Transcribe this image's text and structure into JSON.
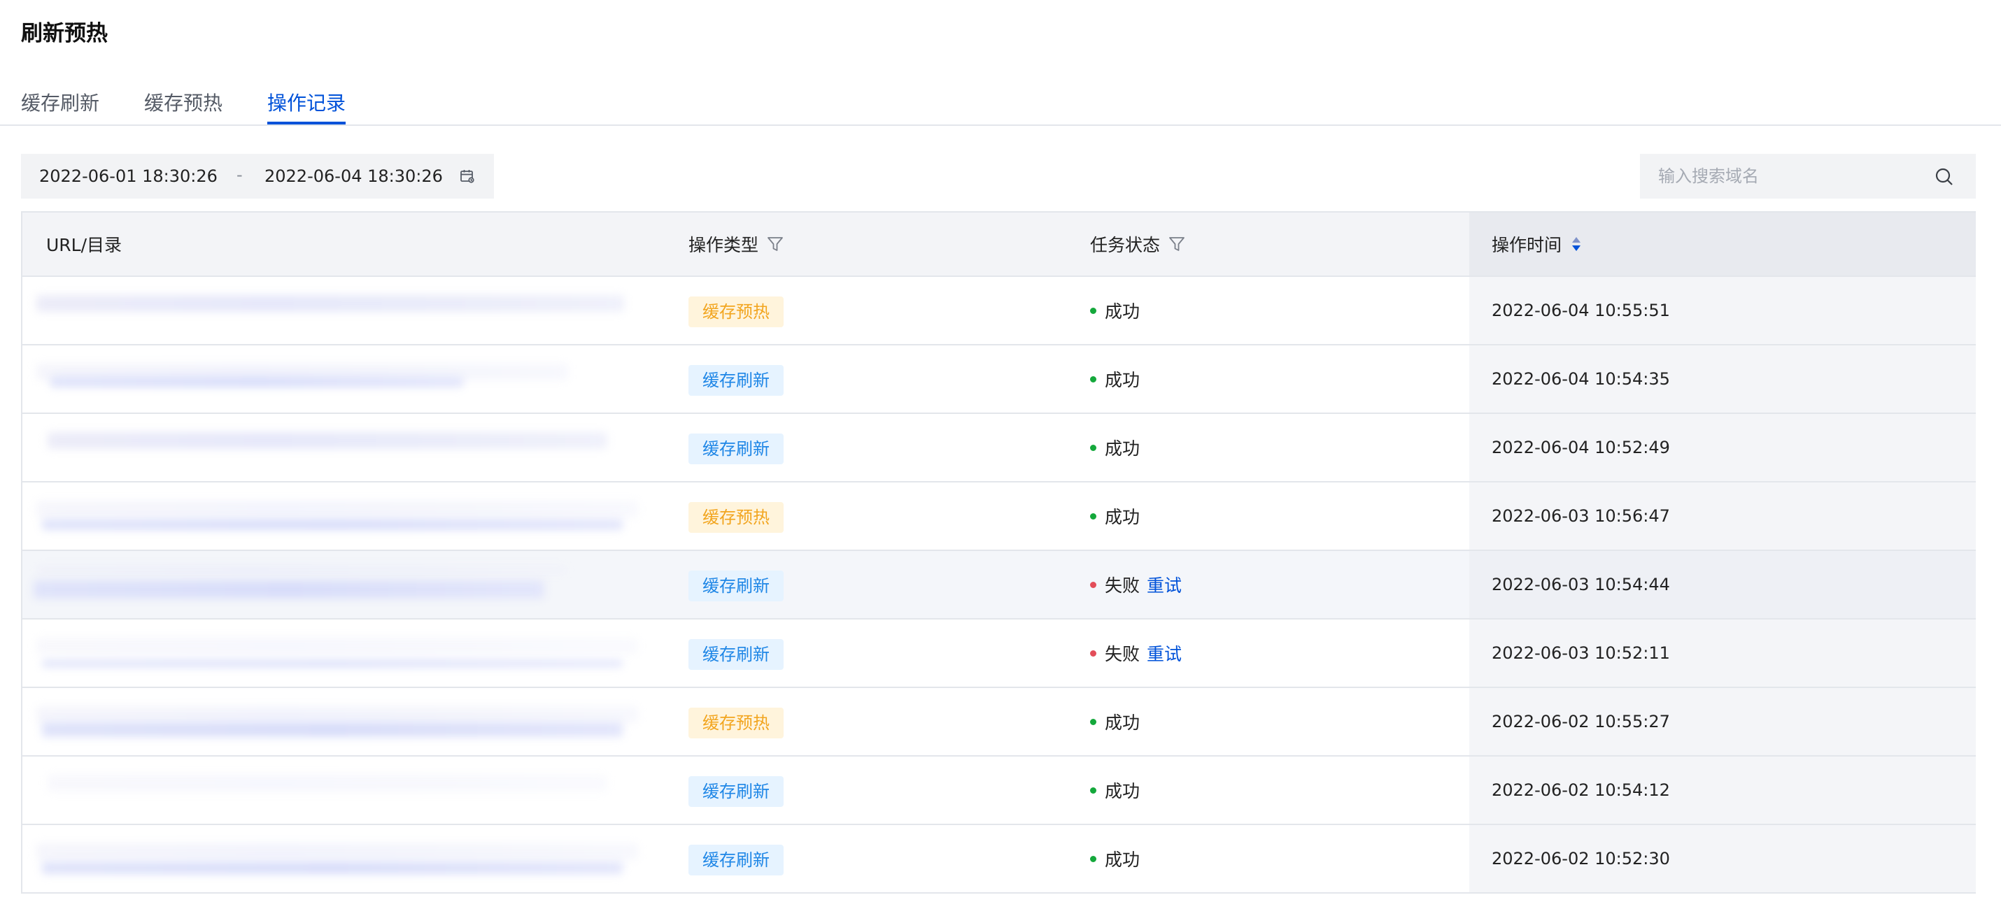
{
  "page": {
    "title": "刷新预热"
  },
  "tabs": [
    {
      "label": "缓存刷新",
      "active": false
    },
    {
      "label": "缓存预热",
      "active": false
    },
    {
      "label": "操作记录",
      "active": true
    }
  ],
  "date_range": {
    "start": "2022-06-01 18:30:26",
    "separator": "-",
    "end": "2022-06-04 18:30:26",
    "icon": "calendar-icon"
  },
  "search": {
    "placeholder": "输入搜索域名",
    "value": "",
    "icon": "search-icon"
  },
  "table": {
    "columns": {
      "url": "URL/目录",
      "type": "操作类型",
      "status": "任务状态",
      "time": "操作时间"
    },
    "rows": [
      {
        "type": "缓存预热",
        "type_kind": "preheat",
        "status": "成功",
        "status_kind": "ok",
        "retry": "",
        "time": "2022-06-04 10:55:51"
      },
      {
        "type": "缓存刷新",
        "type_kind": "refresh",
        "status": "成功",
        "status_kind": "ok",
        "retry": "",
        "time": "2022-06-04 10:54:35"
      },
      {
        "type": "缓存刷新",
        "type_kind": "refresh",
        "status": "成功",
        "status_kind": "ok",
        "retry": "",
        "time": "2022-06-04 10:52:49"
      },
      {
        "type": "缓存预热",
        "type_kind": "preheat",
        "status": "成功",
        "status_kind": "ok",
        "retry": "",
        "time": "2022-06-03 10:56:47"
      },
      {
        "type": "缓存刷新",
        "type_kind": "refresh",
        "status": "失败",
        "status_kind": "fail",
        "retry": "重试",
        "time": "2022-06-03 10:54:44"
      },
      {
        "type": "缓存刷新",
        "type_kind": "refresh",
        "status": "失败",
        "status_kind": "fail",
        "retry": "重试",
        "time": "2022-06-03 10:52:11"
      },
      {
        "type": "缓存预热",
        "type_kind": "preheat",
        "status": "成功",
        "status_kind": "ok",
        "retry": "",
        "time": "2022-06-02 10:55:27"
      },
      {
        "type": "缓存刷新",
        "type_kind": "refresh",
        "status": "成功",
        "status_kind": "ok",
        "retry": "",
        "time": "2022-06-02 10:54:12"
      },
      {
        "type": "缓存刷新",
        "type_kind": "refresh",
        "status": "成功",
        "status_kind": "ok",
        "retry": "",
        "time": "2022-06-02 10:52:30"
      }
    ]
  },
  "colors": {
    "accent": "#0052d9",
    "success": "#14a83b",
    "fail": "#e34d59",
    "refresh_tag_text": "#1e86e6",
    "preheat_tag_text": "#f2a51f"
  }
}
